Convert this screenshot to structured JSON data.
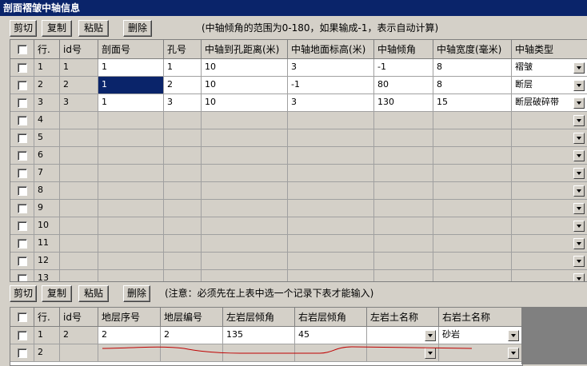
{
  "window": {
    "title": "剖面褶皱中轴信息"
  },
  "toolbar_top": {
    "cut": "剪切",
    "copy": "复制",
    "paste": "粘贴",
    "delete": "删除",
    "note": "(中轴倾角的范围为0-180，如果输成-1，表示自动计算)"
  },
  "top_table": {
    "headers": [
      "行.",
      "id号",
      "剖面号",
      "孔号",
      "中轴到孔距离(米)",
      "中轴地面标高(米)",
      "中轴倾角",
      "中轴宽度(毫米)",
      "中轴类型"
    ],
    "rows": [
      {
        "row": "1",
        "id": "1",
        "section": "1",
        "hole": "1",
        "distance": "10",
        "elevation": "3",
        "dip": "-1",
        "width": "8",
        "type": "褶皱"
      },
      {
        "row": "2",
        "id": "2",
        "section": "1",
        "hole": "2",
        "distance": "10",
        "elevation": "-1",
        "dip": "80",
        "width": "8",
        "type": "断层"
      },
      {
        "row": "3",
        "id": "3",
        "section": "1",
        "hole": "3",
        "distance": "10",
        "elevation": "3",
        "dip": "130",
        "width": "15",
        "type": "断层破碎带"
      },
      {
        "row": "4"
      },
      {
        "row": "5"
      },
      {
        "row": "6"
      },
      {
        "row": "7"
      },
      {
        "row": "8"
      },
      {
        "row": "9"
      },
      {
        "row": "10"
      },
      {
        "row": "11"
      },
      {
        "row": "12"
      },
      {
        "row": "13"
      }
    ]
  },
  "toolbar_bottom": {
    "cut": "剪切",
    "copy": "复制",
    "paste": "粘贴",
    "delete": "删除",
    "note": "(注意：必须先在上表中选一个记录下表才能输入)"
  },
  "bottom_table": {
    "headers": [
      "行.",
      "id号",
      "地层序号",
      "地层编号",
      "左岩层倾角",
      "右岩层倾角",
      "左岩土名称",
      "右岩土名称"
    ],
    "rows": [
      {
        "row": "1",
        "id": "2",
        "seq": "2",
        "code": "2",
        "left_dip": "135",
        "right_dip": "45",
        "left_name": "",
        "right_name": "砂岩"
      },
      {
        "row": "2"
      }
    ]
  },
  "colors": {
    "selection": "#0a246a",
    "title_bar": "#0a246a",
    "annotation": "#c00000"
  }
}
